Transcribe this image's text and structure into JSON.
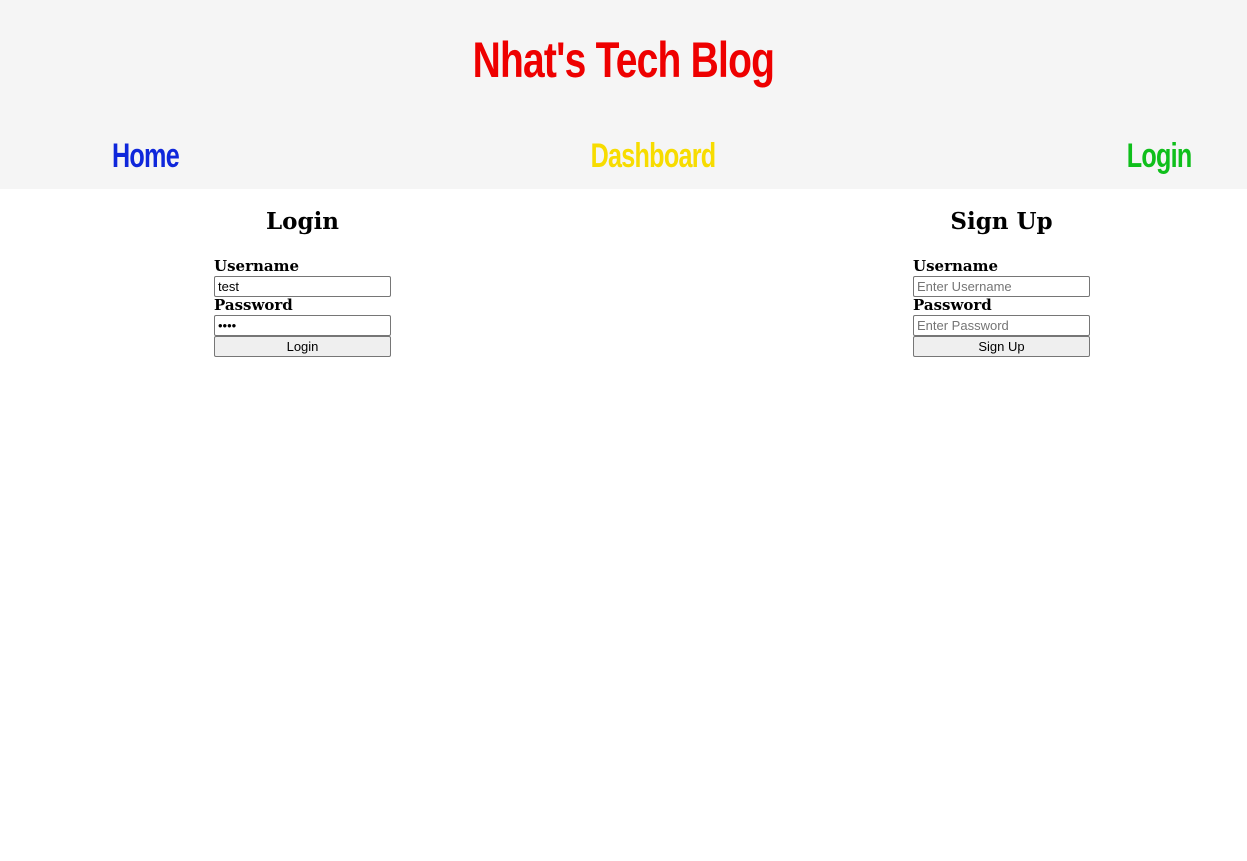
{
  "header": {
    "site_title": "Nhat's Tech Blog",
    "background": "#f5f5f5",
    "title_color": "#ee0000",
    "nav": {
      "home": {
        "label": "Home",
        "color": "#0f27db"
      },
      "dashboard": {
        "label": "Dashboard",
        "color": "#f7dc00"
      },
      "login": {
        "label": "Login",
        "color": "#0fbf1b"
      }
    }
  },
  "login_form": {
    "title": "Login",
    "username_label": "Username",
    "username_value": "test",
    "password_label": "Password",
    "password_value": "test",
    "submit_label": "Login"
  },
  "signup_form": {
    "title": "Sign Up",
    "username_label": "Username",
    "username_placeholder": "Enter Username",
    "password_label": "Password",
    "password_placeholder": "Enter Password",
    "submit_label": "Sign Up"
  }
}
